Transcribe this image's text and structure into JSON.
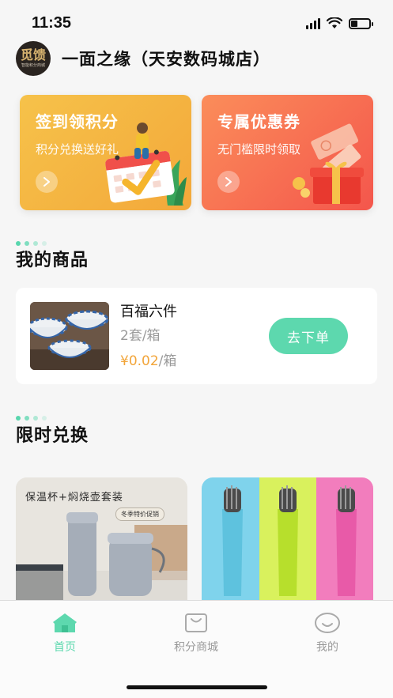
{
  "status_bar": {
    "time": "11:35"
  },
  "store": {
    "name": "一面之缘（天安数码城店）",
    "logo_mark": "觅馈",
    "logo_sub": "智能积分商城"
  },
  "promos": [
    {
      "title": "签到领积分",
      "subtitle": "积分兑换送好礼",
      "icon": "calendar-check-icon"
    },
    {
      "title": "专属优惠券",
      "subtitle": "无门槛限时领取",
      "icon": "gift-box-icon"
    }
  ],
  "my_products": {
    "title": "我的商品",
    "items": [
      {
        "name": "百福六件",
        "spec": "2套/箱",
        "price": "¥0.02",
        "unit": "/箱",
        "action": "去下单"
      }
    ]
  },
  "flash_exchange": {
    "title": "限时兑换",
    "items": [
      {
        "banner_text": "保温杯+焖烧壶套装",
        "badge": "冬季特价促销"
      },
      {
        "banner_text": ""
      }
    ]
  },
  "tab_bar": {
    "items": [
      {
        "label": "首页",
        "icon": "home-icon",
        "active": true
      },
      {
        "label": "积分商城",
        "icon": "shop-bag-icon",
        "active": false
      },
      {
        "label": "我的",
        "icon": "smile-face-icon",
        "active": false
      }
    ]
  },
  "colors": {
    "accent": "#5dd8ae",
    "price": "#f2a53a",
    "checkin_card": "#f4b43f",
    "coupon_card": "#f56a4f"
  }
}
